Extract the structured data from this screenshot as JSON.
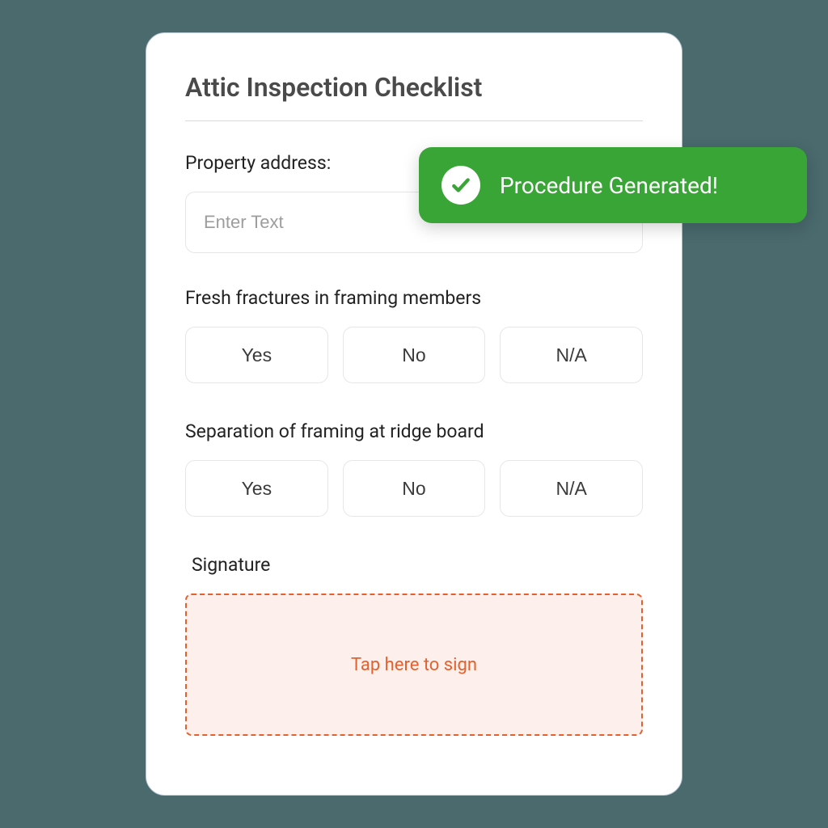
{
  "title": "Attic Inspection Checklist",
  "fields": {
    "propertyAddress": {
      "label": "Property address:",
      "placeholder": "Enter Text"
    },
    "freshFractures": {
      "label": "Fresh fractures in framing members",
      "options": {
        "yes": "Yes",
        "no": "No",
        "na": "N/A"
      }
    },
    "separationFraming": {
      "label": "Separation of framing at ridge board",
      "options": {
        "yes": "Yes",
        "no": "No",
        "na": "N/A"
      }
    },
    "signature": {
      "label": "Signature",
      "placeholder": "Tap here to sign"
    }
  },
  "toast": {
    "message": "Procedure Generated!"
  },
  "colors": {
    "background": "#4a6a6e",
    "toastBg": "#3aa537",
    "accent": "#e2612e"
  }
}
